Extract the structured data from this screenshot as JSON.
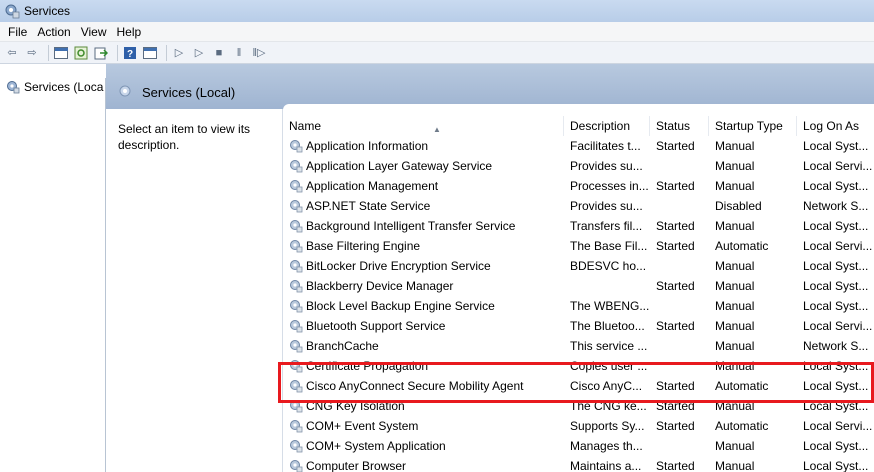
{
  "window": {
    "title": "Services"
  },
  "menu": [
    "File",
    "Action",
    "View",
    "Help"
  ],
  "toolbar": {
    "icons": [
      "back-icon",
      "forward-icon",
      "up-icon",
      "show-console-tree-icon",
      "refresh-icon",
      "export-icon",
      "help-icon",
      "properties-icon",
      "start-icon",
      "start-alt-icon",
      "stop-icon",
      "pause-icon",
      "resume-icon"
    ]
  },
  "tree": {
    "root_label": "Services (Loca"
  },
  "panel": {
    "title": "Services (Local)"
  },
  "description_pane": {
    "text": "Select an item to view its description."
  },
  "columns": [
    "Name",
    "Description",
    "Status",
    "Startup Type",
    "Log On As"
  ],
  "rows": [
    {
      "name": "Application Information",
      "description": "Facilitates t...",
      "status": "Started",
      "startup": "Manual",
      "logon": "Local Syst..."
    },
    {
      "name": "Application Layer Gateway Service",
      "description": "Provides su...",
      "status": "",
      "startup": "Manual",
      "logon": "Local Servi..."
    },
    {
      "name": "Application Management",
      "description": "Processes in...",
      "status": "Started",
      "startup": "Manual",
      "logon": "Local Syst..."
    },
    {
      "name": "ASP.NET State Service",
      "description": "Provides su...",
      "status": "",
      "startup": "Disabled",
      "logon": "Network S..."
    },
    {
      "name": "Background Intelligent Transfer Service",
      "description": "Transfers fil...",
      "status": "Started",
      "startup": "Manual",
      "logon": "Local Syst..."
    },
    {
      "name": "Base Filtering Engine",
      "description": "The Base Fil...",
      "status": "Started",
      "startup": "Automatic",
      "logon": "Local Servi..."
    },
    {
      "name": "BitLocker Drive Encryption Service",
      "description": "BDESVC ho...",
      "status": "",
      "startup": "Manual",
      "logon": "Local Syst..."
    },
    {
      "name": "Blackberry Device Manager",
      "description": "",
      "status": "Started",
      "startup": "Manual",
      "logon": "Local Syst..."
    },
    {
      "name": "Block Level Backup Engine Service",
      "description": "The WBENG...",
      "status": "",
      "startup": "Manual",
      "logon": "Local Syst..."
    },
    {
      "name": "Bluetooth Support Service",
      "description": "The Bluetoo...",
      "status": "Started",
      "startup": "Manual",
      "logon": "Local Servi..."
    },
    {
      "name": "BranchCache",
      "description": "This service ...",
      "status": "",
      "startup": "Manual",
      "logon": "Network S..."
    },
    {
      "name": "Certificate Propagation",
      "description": "Copies user ...",
      "status": "",
      "startup": "Manual",
      "logon": "Local Syst..."
    },
    {
      "name": "Cisco AnyConnect Secure Mobility Agent",
      "description": "Cisco AnyC...",
      "status": "Started",
      "startup": "Automatic",
      "logon": "Local Syst..."
    },
    {
      "name": "CNG Key Isolation",
      "description": "The CNG ke...",
      "status": "Started",
      "startup": "Manual",
      "logon": "Local Syst..."
    },
    {
      "name": "COM+ Event System",
      "description": "Supports Sy...",
      "status": "Started",
      "startup": "Automatic",
      "logon": "Local Servi..."
    },
    {
      "name": "COM+ System Application",
      "description": "Manages th...",
      "status": "",
      "startup": "Manual",
      "logon": "Local Syst..."
    },
    {
      "name": "Computer Browser",
      "description": "Maintains a...",
      "status": "Started",
      "startup": "Manual",
      "logon": "Local Syst..."
    }
  ],
  "colors": {
    "highlight": "#e8191e",
    "header_gradient": "#b8c9df"
  }
}
